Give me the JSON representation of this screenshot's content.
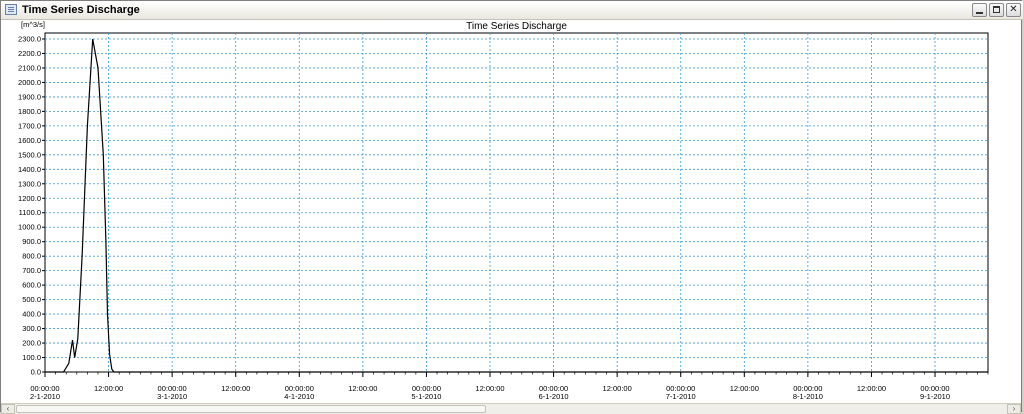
{
  "window": {
    "title": "Time Series Discharge",
    "minimize_label": "",
    "maximize_label": "",
    "close_label": "✕"
  },
  "chart_data": {
    "type": "line",
    "title": "Time Series Discharge",
    "ylabel": "[m^3/s]",
    "xlabel": "",
    "ylim": [
      0,
      2300
    ],
    "y_tick_step": 100,
    "y_ticks": [
      "0.0",
      "100.0",
      "200.0",
      "300.0",
      "400.0",
      "500.0",
      "600.0",
      "700.0",
      "800.0",
      "900.0",
      "1000.0",
      "1100.0",
      "1200.0",
      "1300.0",
      "1400.0",
      "1500.0",
      "1600.0",
      "1700.0",
      "1800.0",
      "1900.0",
      "2000.0",
      "2100.0",
      "2200.0",
      "2300.0"
    ],
    "x_range_hours": [
      0,
      178
    ],
    "x_ticks": [
      {
        "hour": 0,
        "time": "00:00:00",
        "date": "2-1-2010"
      },
      {
        "hour": 12,
        "time": "12:00:00",
        "date": ""
      },
      {
        "hour": 24,
        "time": "00:00:00",
        "date": "3-1-2010"
      },
      {
        "hour": 36,
        "time": "12:00:00",
        "date": ""
      },
      {
        "hour": 48,
        "time": "00:00:00",
        "date": "4-1-2010"
      },
      {
        "hour": 60,
        "time": "12:00:00",
        "date": ""
      },
      {
        "hour": 72,
        "time": "00:00:00",
        "date": "5-1-2010"
      },
      {
        "hour": 84,
        "time": "12:00:00",
        "date": ""
      },
      {
        "hour": 96,
        "time": "00:00:00",
        "date": "6-1-2010"
      },
      {
        "hour": 108,
        "time": "12:00:00",
        "date": ""
      },
      {
        "hour": 120,
        "time": "00:00:00",
        "date": "7-1-2010"
      },
      {
        "hour": 132,
        "time": "12:00:00",
        "date": ""
      },
      {
        "hour": 144,
        "time": "00:00:00",
        "date": "8-1-2010"
      },
      {
        "hour": 156,
        "time": "12:00:00",
        "date": ""
      },
      {
        "hour": 168,
        "time": "00:00:00",
        "date": "9-1-2010"
      }
    ],
    "grid": true,
    "series": [
      {
        "color": "#000000",
        "x_hours": [
          0,
          3.5,
          4.5,
          5.2,
          5.6,
          6.2,
          7.0,
          8.0,
          9.0,
          10.0,
          11.0,
          11.5,
          11.8,
          12.2,
          12.6,
          13.0,
          14.0,
          20,
          40,
          80,
          120,
          178
        ],
        "values": [
          0,
          0,
          60,
          220,
          100,
          230,
          800,
          1700,
          2300,
          2100,
          1500,
          900,
          400,
          120,
          20,
          0,
          0,
          0,
          0,
          0,
          0,
          0
        ]
      }
    ]
  }
}
